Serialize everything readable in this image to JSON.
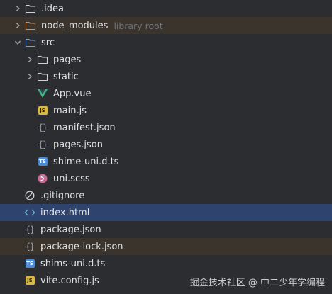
{
  "tree": {
    "idea": {
      "label": ".idea"
    },
    "node_modules": {
      "label": "node_modules",
      "hint": "library root"
    },
    "src": {
      "label": "src"
    },
    "pages": {
      "label": "pages"
    },
    "static": {
      "label": "static"
    },
    "app_vue": {
      "label": "App.vue"
    },
    "main_js": {
      "label": "main.js",
      "badge": "JS"
    },
    "manifest_json": {
      "label": "manifest.json"
    },
    "pages_json": {
      "label": "pages.json"
    },
    "shime_uni": {
      "label": "shime-uni.d.ts",
      "badge": "TS"
    },
    "uni_scss": {
      "label": "uni.scss"
    },
    "gitignore": {
      "label": ".gitignore"
    },
    "index_html": {
      "label": "index.html"
    },
    "package_json": {
      "label": "package.json"
    },
    "package_lock": {
      "label": "package-lock.json"
    },
    "shims_uni": {
      "label": "shims-uni.d.ts",
      "badge": "TS"
    },
    "vite_config": {
      "label": "vite.config.js",
      "badge": "JS"
    }
  },
  "watermark": "掘金技术社区 @ 中二少年学编程",
  "colors": {
    "background": "#2b2d30",
    "selected_row": "#2e436e",
    "excluded_row": "#3b342c",
    "text": "#dfe1e5",
    "hint_text": "#6f737a",
    "vue_green": "#41b883",
    "js_badge": "#d9b844",
    "ts_badge": "#4d8ad6",
    "sass_pink": "#cd6799"
  }
}
